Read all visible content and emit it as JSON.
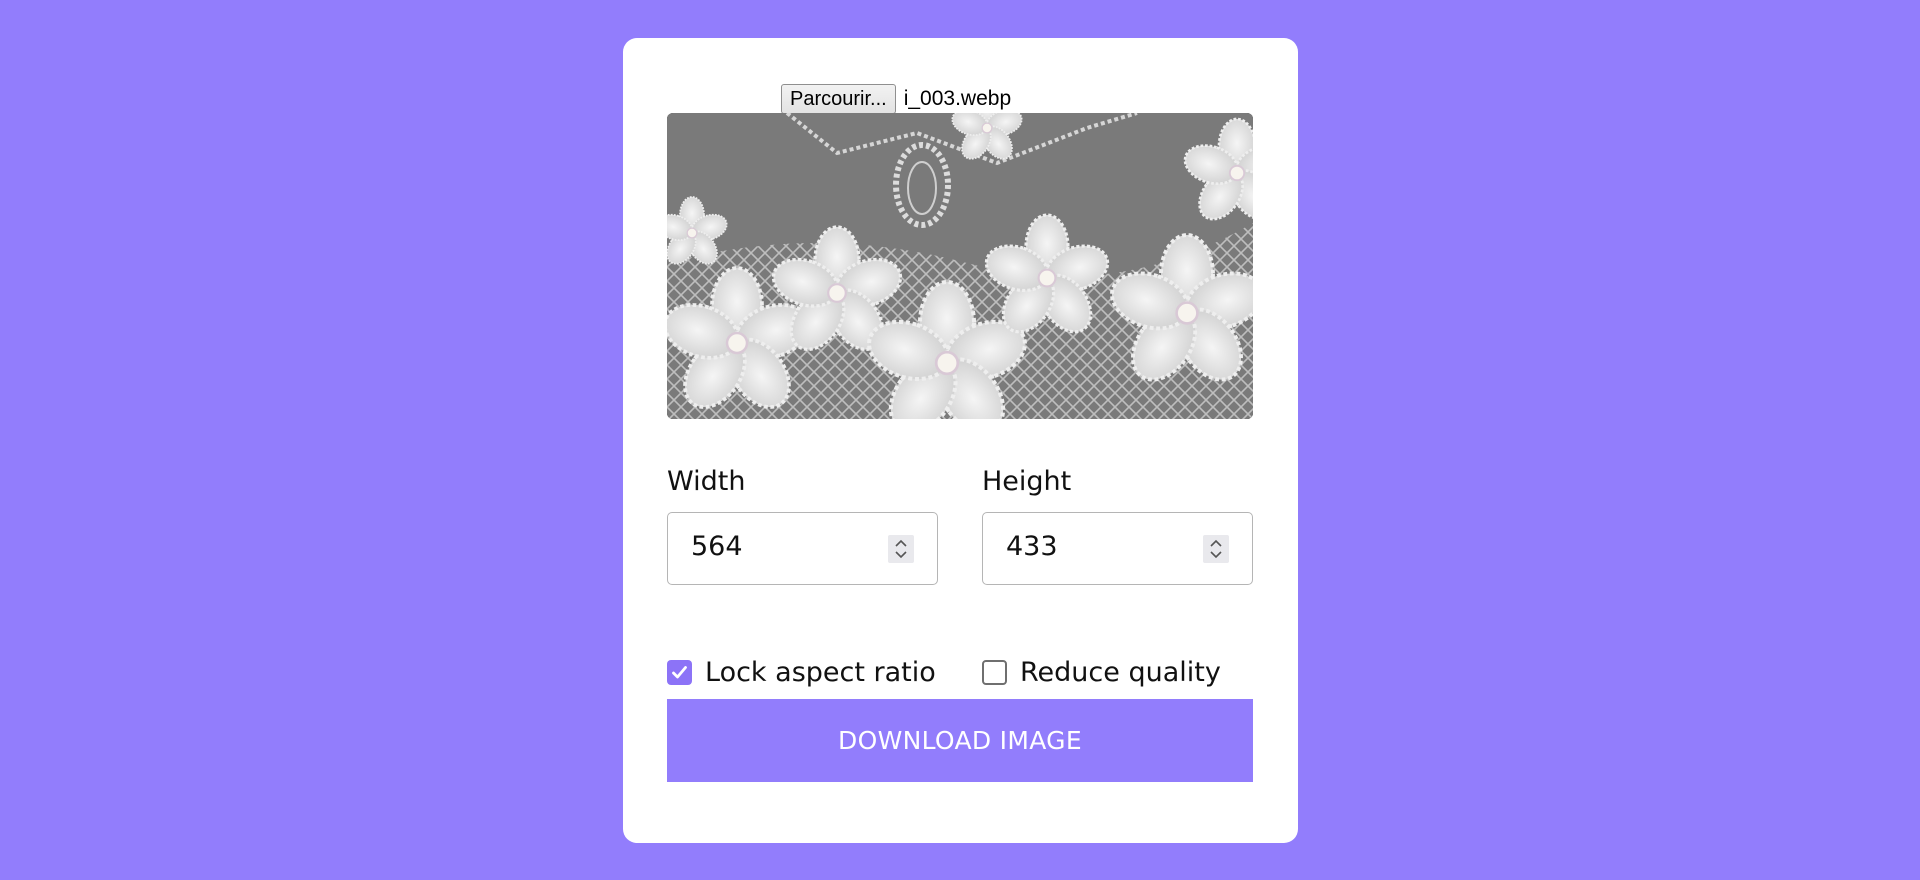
{
  "colors": {
    "background": "#927DFC",
    "card": "#FFFFFF",
    "accent": "#927DFC",
    "checkbox_checked": "#8C73F7"
  },
  "file_input": {
    "button_label": "Parcourir...",
    "file_name": "i_003.webp"
  },
  "preview": {
    "icon": "image-preview-beaded-lace-flowers"
  },
  "width_field": {
    "label": "Width",
    "value": "564"
  },
  "height_field": {
    "label": "Height",
    "value": "433"
  },
  "options": {
    "lock_aspect_ratio": {
      "label": "Lock aspect ratio",
      "checked": true
    },
    "reduce_quality": {
      "label": "Reduce quality",
      "checked": false
    }
  },
  "download_button": {
    "label": "DOWNLOAD IMAGE"
  }
}
